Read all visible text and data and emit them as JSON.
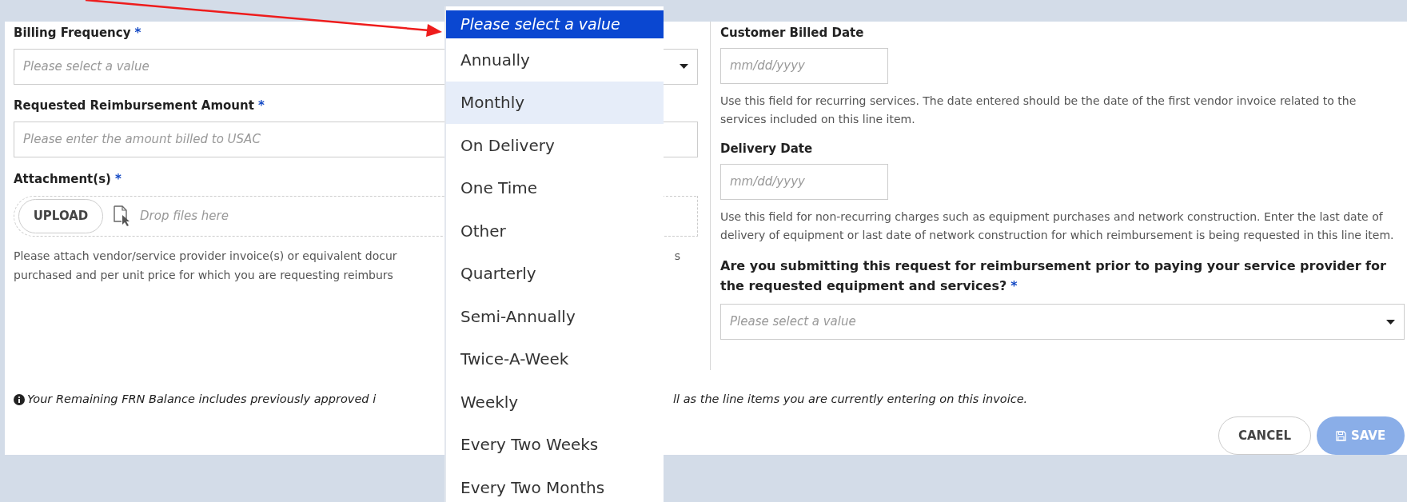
{
  "left": {
    "billing_frequency": {
      "label": "Billing Frequency",
      "required_mark": "*",
      "placeholder": "Please select a value"
    },
    "reimbursement_amount": {
      "label": "Requested Reimbursement Amount",
      "required_mark": "*",
      "placeholder": "Please enter the amount billed to USAC"
    },
    "attachments": {
      "label": "Attachment(s)",
      "required_mark": "*",
      "upload_button": "UPLOAD",
      "drop_hint": "Drop files here",
      "help_lines": [
        "Please attach vendor/service provider invoice(s) or equivalent docur",
        "purchased and per unit price for which you are requesting reimburs"
      ],
      "help_tail": "s"
    }
  },
  "right": {
    "customer_billed_date": {
      "label": "Customer Billed Date",
      "placeholder": "mm/dd/yyyy",
      "help": "Use this field for recurring services. The date entered should be the date of the first vendor invoice related to the services included on this line item."
    },
    "delivery_date": {
      "label": "Delivery Date",
      "placeholder": "mm/dd/yyyy",
      "help": "Use this field for non-recurring charges such as equipment purchases and network construction. Enter the last date of delivery of equipment or last date of network construction for which reimbursement is being requested in this line item."
    },
    "prepay_question": {
      "label": "Are you submitting this request for reimbursement prior to paying your service provider for the requested equipment and services?",
      "required_mark": "*",
      "placeholder": "Please select a value"
    }
  },
  "footnote": {
    "left": "Your Remaining FRN Balance includes previously approved i",
    "right": "ll as the line items you are currently entering on this invoice."
  },
  "buttons": [
    {
      "label": "CANCEL",
      "kind": "secondary",
      "disabled": false
    },
    {
      "label": "SAVE",
      "kind": "primary",
      "disabled": true
    }
  ],
  "dropdown": {
    "options": [
      {
        "label": "Please select a value",
        "selected": true,
        "highlighted": false
      },
      {
        "label": "Annually",
        "selected": false,
        "highlighted": false
      },
      {
        "label": "Monthly",
        "selected": false,
        "highlighted": true
      },
      {
        "label": "On Delivery",
        "selected": false,
        "highlighted": false
      },
      {
        "label": "One Time",
        "selected": false,
        "highlighted": false
      },
      {
        "label": "Other",
        "selected": false,
        "highlighted": false
      },
      {
        "label": "Quarterly",
        "selected": false,
        "highlighted": false
      },
      {
        "label": "Semi-Annually",
        "selected": false,
        "highlighted": false
      },
      {
        "label": "Twice-A-Week",
        "selected": false,
        "highlighted": false
      },
      {
        "label": "Weekly",
        "selected": false,
        "highlighted": false
      },
      {
        "label": "Every Two Weeks",
        "selected": false,
        "highlighted": false
      },
      {
        "label": "Every Two Months",
        "selected": false,
        "highlighted": false
      }
    ]
  }
}
